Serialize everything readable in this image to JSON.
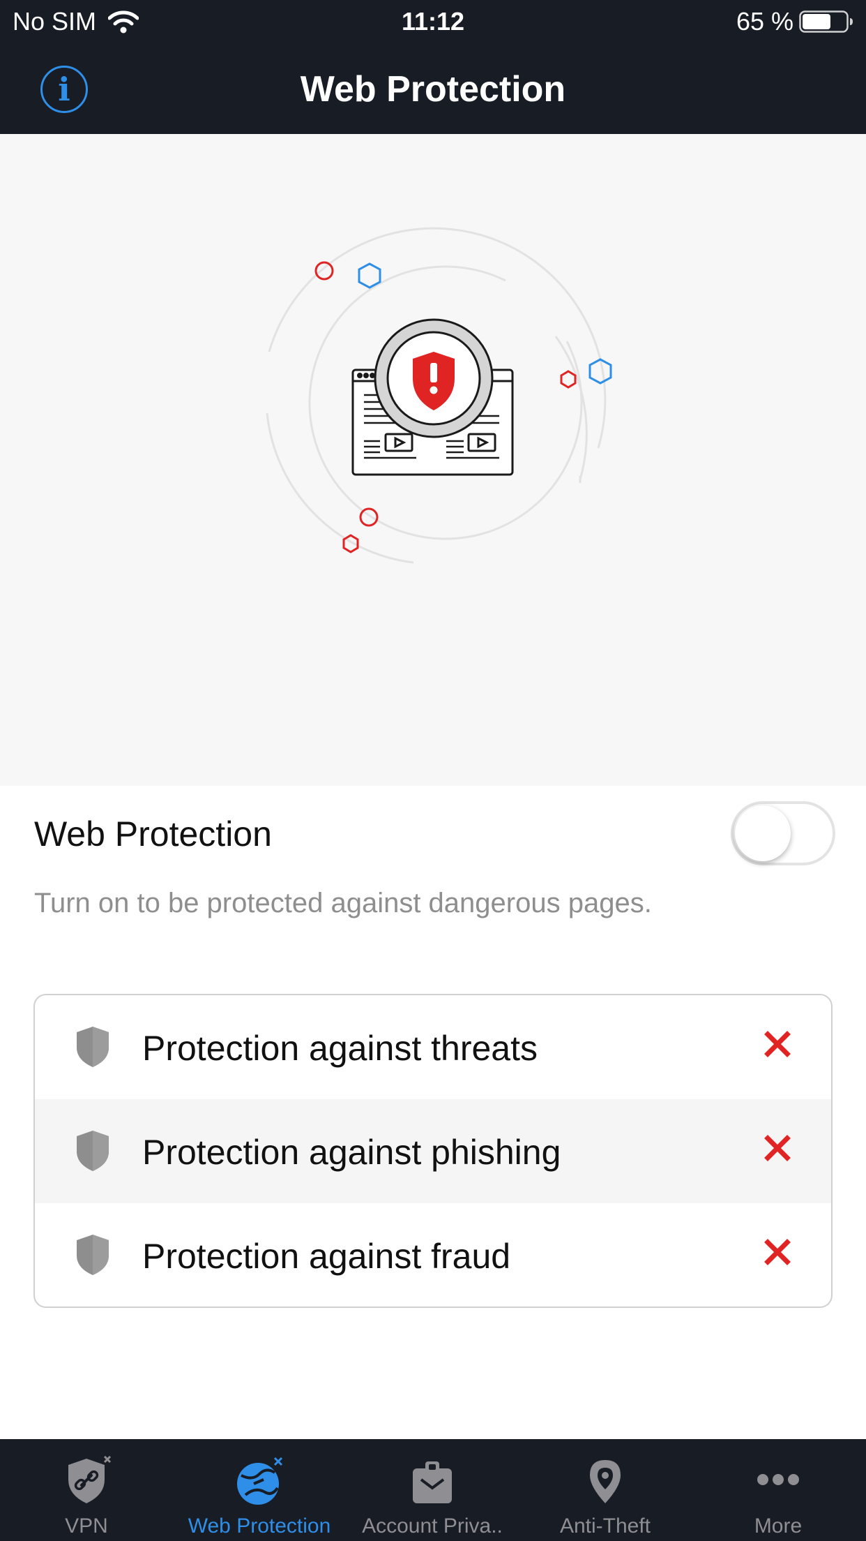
{
  "status_bar": {
    "carrier": "No SIM",
    "time": "11:12",
    "battery_percent": "65 %",
    "battery_level": 0.65
  },
  "nav": {
    "title": "Web Protection",
    "info_icon": "info-icon"
  },
  "toggle_section": {
    "label": "Web Protection",
    "enabled": false,
    "description": "Turn on to be protected against dangerous pages."
  },
  "features": [
    {
      "label": "Protection against threats",
      "icon": "shield-icon",
      "status": "disabled",
      "status_icon": "x-icon"
    },
    {
      "label": "Protection against phishing",
      "icon": "shield-icon",
      "status": "disabled",
      "status_icon": "x-icon"
    },
    {
      "label": "Protection against fraud",
      "icon": "shield-icon",
      "status": "disabled",
      "status_icon": "x-icon"
    }
  ],
  "tabs": [
    {
      "label": "VPN",
      "icon": "vpn-shield-icon",
      "active": false
    },
    {
      "label": "Web Protection",
      "icon": "web-protection-globe-icon",
      "active": true
    },
    {
      "label": "Account Priva..",
      "icon": "account-privacy-clipboard-icon",
      "active": false
    },
    {
      "label": "Anti-Theft",
      "icon": "anti-theft-location-icon",
      "active": false
    },
    {
      "label": "More",
      "icon": "more-dots-icon",
      "active": false
    }
  ],
  "colors": {
    "dark_bar": "#181c24",
    "accent_blue": "#2f8fe8",
    "danger_red": "#e02424",
    "hero_bg": "#f7f7f7",
    "inactive_gray": "#8e8e93"
  }
}
